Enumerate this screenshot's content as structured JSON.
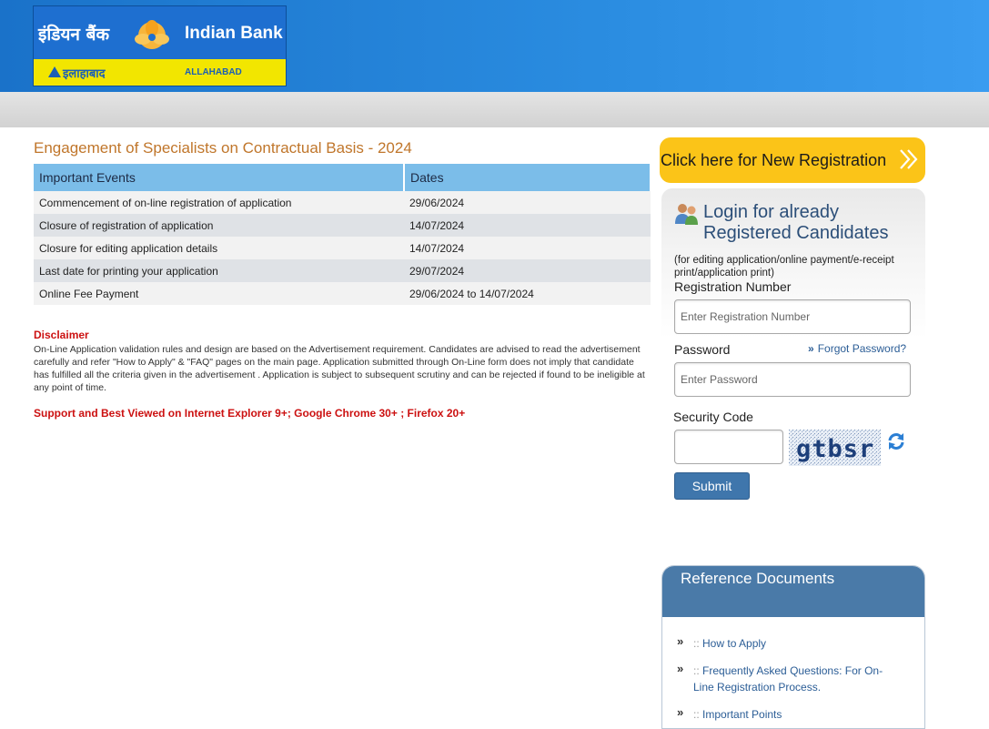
{
  "header": {
    "logo_hindi": "इंडियन बैंक",
    "logo_english": "Indian Bank",
    "logo_allahabad_hindi": "इलाहाबाद",
    "logo_allahabad_english": "ALLAHABAD",
    "brand_blue": "#1a72c9",
    "brand_yellow": "#f2e600"
  },
  "main": {
    "title": "Engagement of Specialists on Contractual Basis - 2024",
    "events_table": {
      "headers": [
        "Important Events",
        "Dates"
      ],
      "rows": [
        [
          "Commencement of on-line registration of application",
          "29/06/2024"
        ],
        [
          "Closure of registration of application",
          "14/07/2024"
        ],
        [
          "Closure for editing application details",
          "14/07/2024"
        ],
        [
          "Last date for printing your application",
          "29/07/2024"
        ],
        [
          "Online Fee Payment",
          "29/06/2024 to 14/07/2024"
        ]
      ]
    },
    "disclaimer_heading": "Disclaimer",
    "disclaimer_text": "On-Line Application validation rules and design are based on the Advertisement requirement. Candidates are advised to read the advertisement carefully and refer \"How to Apply\" & \"FAQ\" pages on the main page. Application submitted through On-Line form does not imply that candidate has fulfilled all the criteria given in the advertisement . Application is subject to subsequent scrutiny and can be rejected if found to be ineligible at any point of time.",
    "support_text": "Support and Best Viewed on Internet Explorer 9+; Google Chrome 30+ ; Firefox 20+"
  },
  "sidebar": {
    "new_registration_label": "Click here for New Registration",
    "login": {
      "title_line1": "Login for already",
      "title_line2": "Registered Candidates",
      "note": "(for editing application/online payment/e-receipt print/application print)",
      "registration_label": "Registration Number",
      "registration_placeholder": "Enter Registration Number",
      "registration_value": "",
      "password_label": "Password",
      "password_placeholder": "Enter Password",
      "password_value": "",
      "forgot_password": "Forgot Password?",
      "security_code_label": "Security Code",
      "security_code_value": "",
      "captcha_text": "gtbsr",
      "submit_label": "Submit"
    },
    "reference": {
      "title": "Reference Documents",
      "separator": "::",
      "items": [
        "How to Apply",
        "Frequently Asked Questions: For On-Line Registration Process.",
        "Important Points"
      ]
    }
  }
}
